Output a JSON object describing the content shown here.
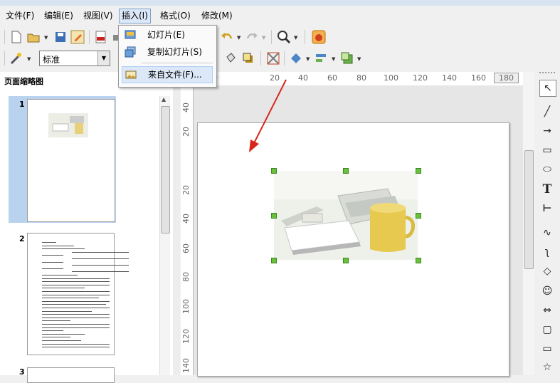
{
  "menubar": {
    "items": [
      {
        "label": "文件(F)"
      },
      {
        "label": "编辑(E)"
      },
      {
        "label": "视图(V)"
      },
      {
        "label": "插入(I)"
      },
      {
        "label": "格式(O)"
      },
      {
        "label": "修改(M)"
      }
    ]
  },
  "insert_menu": {
    "items": [
      {
        "label": "幻灯片(E)",
        "icon": "slide-icon"
      },
      {
        "label": "复制幻灯片(S)",
        "icon": "duplicate-slide-icon"
      },
      {
        "label": "来自文件(F)...",
        "icon": "image-file-icon"
      }
    ]
  },
  "toolbar2": {
    "style_value": "标准"
  },
  "slide_pane": {
    "title": "页面缩略图",
    "slides": [
      {
        "number": "1"
      },
      {
        "number": "2"
      },
      {
        "number": "3"
      }
    ]
  },
  "ruler_h": [
    "20",
    "40",
    "60",
    "80",
    "100",
    "120",
    "140",
    "160",
    "180"
  ],
  "ruler_v": [
    "40",
    "20",
    "20",
    "40",
    "60",
    "80",
    "100",
    "120",
    "140"
  ],
  "colors": {
    "accent": "#dce8f7",
    "handle": "#6abf3d",
    "arrow": "#d9261c"
  }
}
